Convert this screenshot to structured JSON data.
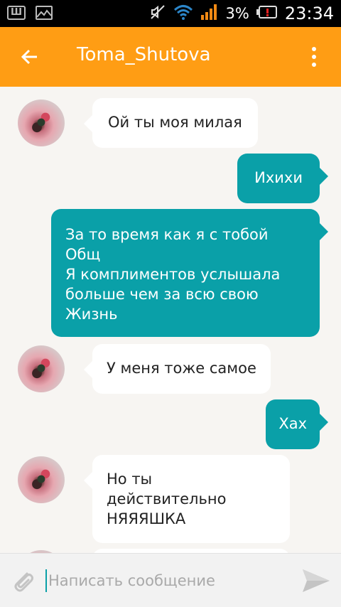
{
  "status_bar": {
    "battery_percent": "3%",
    "time": "23:34",
    "icons": [
      "shop-icon",
      "image-icon",
      "mute-icon",
      "wifi-icon",
      "signal-icon",
      "battery-low-icon"
    ]
  },
  "header": {
    "title": "Toma_Shutova",
    "back_icon": "arrow-left-icon",
    "menu_icon": "more-vertical-icon",
    "color": "#ff9d14"
  },
  "messages": [
    {
      "direction": "in",
      "text": "Ой ты моя милая"
    },
    {
      "direction": "out",
      "text": "Ихихи"
    },
    {
      "direction": "out",
      "text": "За то время как я с тобой\nОбщ\nЯ комплиментов услышала\nбольше чем за всю свою\nЖизнь"
    },
    {
      "direction": "in",
      "text": "У меня тоже самое"
    },
    {
      "direction": "out",
      "text": "Хах"
    },
    {
      "direction": "in",
      "text": "Но ты\nдействительно\nНЯЯЯШКА"
    }
  ],
  "composer": {
    "placeholder": "Написать сообщение",
    "value": "",
    "attach_icon": "paperclip-icon",
    "send_icon": "send-icon"
  },
  "colors": {
    "outgoing_bubble": "#0aa0a8",
    "incoming_bubble": "#ffffff",
    "background": "#f7f5f2"
  }
}
